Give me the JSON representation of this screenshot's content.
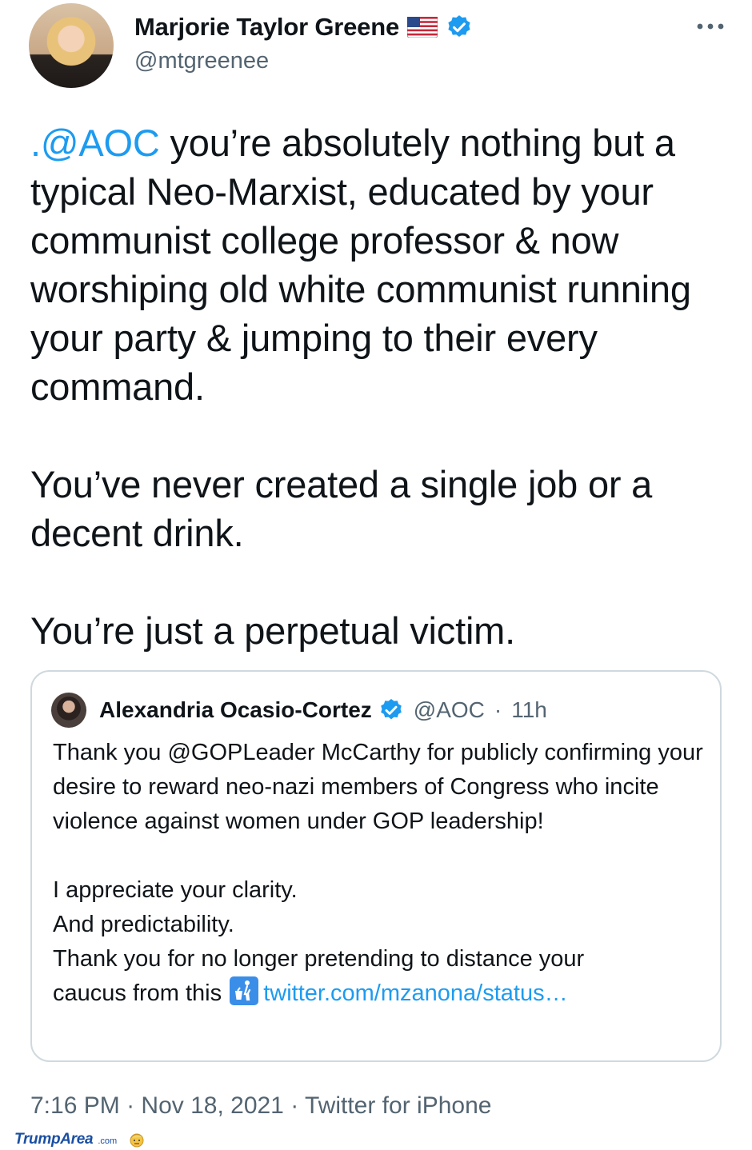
{
  "author": {
    "name": "Marjorie Taylor Greene",
    "handle": "@mtgreenee",
    "flag_icon": "us-flag-icon",
    "verified_icon": "verified-badge-icon"
  },
  "tweet": {
    "mention": ".@AOC",
    "text_part1": " you’re absolutely nothing but a typical Neo-Marxist, educated by your communist college professor & now worshiping old white communist running your party & jumping to their every command.",
    "text_part2": "You’ve never created a single job or a decent drink.",
    "text_part3": "You’re just a perpetual victim."
  },
  "quote": {
    "name": "Alexandria Ocasio-Cortez",
    "handle": "@AOC",
    "separator": "·",
    "time_ago": "11h",
    "text_main": "Thank you @GOPLeader McCarthy for publicly confirming your desire to reward neo-nazi members of Congress who incite violence against women under GOP leadership!",
    "line1": "I appreciate your clarity.",
    "line2": "And predictability.",
    "line3": "Thank you for no longer pretending to distance your",
    "line4_start": "caucus from this",
    "link": "twitter.com/mzanona/status…"
  },
  "footer": {
    "time": "7:16 PM",
    "sep1": " · ",
    "date": "Nov 18, 2021",
    "sep2": " · ",
    "source": "Twitter for iPhone"
  },
  "watermark": {
    "brand": "TrumpArea",
    "suffix": ".com"
  },
  "colors": {
    "link_blue": "#1d9bf0",
    "secondary_text": "#536471",
    "border": "#cfd9de"
  }
}
